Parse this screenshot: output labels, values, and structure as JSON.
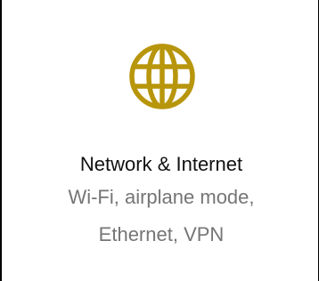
{
  "tile": {
    "title": "Network & Internet",
    "description_lines": [
      "Wi-Fi, airplane mode,",
      "Ethernet, VPN"
    ],
    "icon": "globe-icon"
  },
  "colors": {
    "accent": "#B8960C",
    "title_text": "#111111",
    "description_text": "#757575",
    "background": "#FFFFFF"
  }
}
